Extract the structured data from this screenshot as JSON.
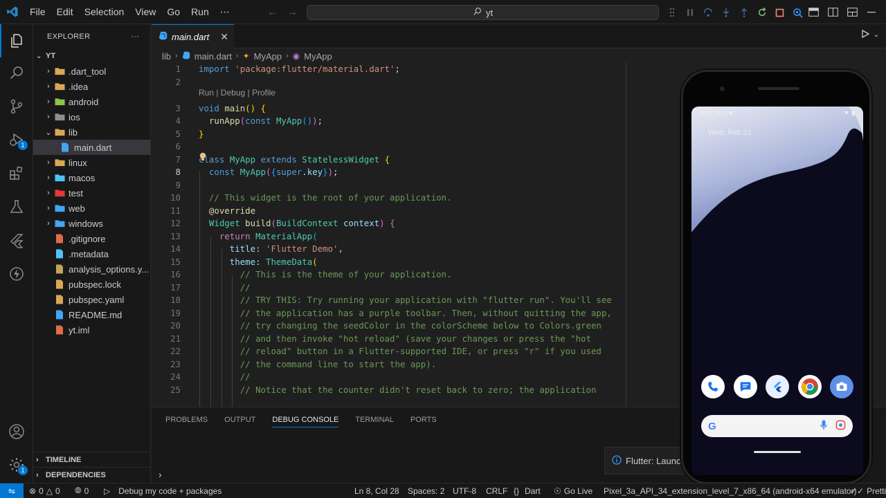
{
  "titlebar": {
    "menu": [
      "File",
      "Edit",
      "Selection",
      "View",
      "Go",
      "Run",
      "⋯"
    ],
    "search_text": "yt"
  },
  "activity": {
    "debug_badge": "1",
    "settings_badge": "1"
  },
  "sidebar": {
    "title": "EXPLORER",
    "more": "···",
    "root": "YT",
    "items": [
      {
        "label": ".dart_tool",
        "kind": "folder",
        "icon_color": "#d9a857"
      },
      {
        "label": ".idea",
        "kind": "folder",
        "icon_color": "#d9a857"
      },
      {
        "label": "android",
        "kind": "folder",
        "icon_color": "#8bc34a"
      },
      {
        "label": "ios",
        "kind": "folder",
        "icon_color": "#8e8e8e"
      },
      {
        "label": "lib",
        "kind": "folder-open",
        "icon_color": "#d9a857"
      },
      {
        "label": "main.dart",
        "kind": "file",
        "icon_color": "#42a5f5",
        "selected": true
      },
      {
        "label": "linux",
        "kind": "folder",
        "icon_color": "#d9a857"
      },
      {
        "label": "macos",
        "kind": "folder",
        "icon_color": "#4fc3f7"
      },
      {
        "label": "test",
        "kind": "folder",
        "icon_color": "#e53935"
      },
      {
        "label": "web",
        "kind": "folder",
        "icon_color": "#42a5f5"
      },
      {
        "label": "windows",
        "kind": "folder",
        "icon_color": "#42a5f5"
      },
      {
        "label": ".gitignore",
        "kind": "file",
        "icon_color": "#e06c45"
      },
      {
        "label": ".metadata",
        "kind": "file",
        "icon_color": "#4fc3f7"
      },
      {
        "label": "analysis_options.y...",
        "kind": "file",
        "icon_color": "#c2a35c"
      },
      {
        "label": "pubspec.lock",
        "kind": "file",
        "icon_color": "#d9a857"
      },
      {
        "label": "pubspec.yaml",
        "kind": "file",
        "icon_color": "#d9a857"
      },
      {
        "label": "README.md",
        "kind": "file",
        "icon_color": "#42a5f5"
      },
      {
        "label": "yt.iml",
        "kind": "file",
        "icon_color": "#e06c45"
      }
    ],
    "timeline": "TIMELINE",
    "dependencies": "DEPENDENCIES"
  },
  "editor": {
    "tab_label": "main.dart",
    "breadcrumb": [
      "lib",
      "main.dart",
      "MyApp",
      "MyApp"
    ],
    "codelens": "Run | Debug | Profile",
    "lines": [
      {
        "n": "1",
        "html": "<span class='kw'>import</span> <span class='str'>'package:flutter/material.dart'</span><span class='pl'>;</span>"
      },
      {
        "n": "2",
        "html": ""
      },
      {
        "n": "3",
        "html": "<span class='kw'>void</span> <span class='fn'>main</span><span class='br1'>()</span> <span class='br1'>{</span>"
      },
      {
        "n": "4",
        "html": "  <span class='fn'>runApp</span><span class='br2'>(</span><span class='kw'>const</span> <span class='ty'>MyApp</span><span class='br3'>()</span><span class='br2'>)</span><span class='pl'>;</span>"
      },
      {
        "n": "5",
        "html": "<span class='br1'>}</span>"
      },
      {
        "n": "6",
        "html": ""
      },
      {
        "n": "7",
        "html": "<span class='kw'>class</span> <span class='ty'>MyApp</span> <span class='kw'>extends</span> <span class='ty'>StatelessWidget</span> <span class='br1'>{</span>"
      },
      {
        "n": "8",
        "html": "  <span class='kw'>const</span> <span class='ty'>MyApp</span><span class='br2'>(</span><span class='br3'>{</span><span class='kw'>super</span><span class='pl'>.</span><span class='prop'>key</span><span class='br3'>}</span><span class='br2'>)</span><span class='pl'>;</span>"
      },
      {
        "n": "9",
        "html": ""
      },
      {
        "n": "10",
        "html": "  <span class='cm'>// This widget is the root of your application.</span>"
      },
      {
        "n": "11",
        "html": "  <span class='ann'>@override</span>"
      },
      {
        "n": "12",
        "html": "  <span class='ty'>Widget</span> <span class='fn'>build</span><span class='br2'>(</span><span class='ty'>BuildContext</span> <span class='prop'>context</span><span class='br2'>)</span> <span class='br2'>{</span>"
      },
      {
        "n": "13",
        "html": "    <span class='kw2'>return</span> <span class='ty'>MaterialApp</span><span class='br3'>(</span>"
      },
      {
        "n": "14",
        "html": "      <span class='prop'>title</span><span class='pl'>:</span> <span class='str'>'Flutter Demo'</span><span class='pl'>,</span>"
      },
      {
        "n": "15",
        "html": "      <span class='prop'>theme</span><span class='pl'>:</span> <span class='ty'>ThemeData</span><span class='br1'>(</span>"
      },
      {
        "n": "16",
        "html": "        <span class='cm'>// This is the theme of your application.</span>"
      },
      {
        "n": "17",
        "html": "        <span class='cm'>//</span>"
      },
      {
        "n": "18",
        "html": "        <span class='cm'>// TRY THIS: Try running your application with \"flutter run\". You'll see</span>"
      },
      {
        "n": "19",
        "html": "        <span class='cm'>// the application has a purple toolbar. Then, without quitting the app,</span>"
      },
      {
        "n": "20",
        "html": "        <span class='cm'>// try changing the seedColor in the colorScheme below to Colors.green</span>"
      },
      {
        "n": "21",
        "html": "        <span class='cm'>// and then invoke \"hot reload\" (save your changes or press the \"hot</span>"
      },
      {
        "n": "22",
        "html": "        <span class='cm'>// reload\" button in a Flutter-supported IDE, or press \"r\" if you used</span>"
      },
      {
        "n": "23",
        "html": "        <span class='cm'>// the command line to start the app).</span>"
      },
      {
        "n": "24",
        "html": "        <span class='cm'>//</span>"
      },
      {
        "n": "25",
        "html": "        <span class='cm'>// Notice that the counter didn't reset back to zero; the application</span>"
      }
    ]
  },
  "panel": {
    "tabs": [
      "PROBLEMS",
      "OUTPUT",
      "DEBUG CONSOLE",
      "TERMINAL",
      "PORTS"
    ],
    "active_tab": "DEBUG CONSOLE",
    "prompt": "›",
    "toast": "Flutter: Launc"
  },
  "statusbar": {
    "errors": "0",
    "warnings": "0",
    "ports": "0",
    "debug_config": "Debug my code + packages",
    "position": "Ln 8, Col 28",
    "spaces": "Spaces: 2",
    "encoding": "UTF-8",
    "eol": "CRLF",
    "language": "Dart",
    "live": "Go Live",
    "device": "Pixel_3a_API_34_extension_level_7_x86_64 (android-x64 emulator)",
    "prettier": "Prettie"
  },
  "emulator": {
    "time": "9:25",
    "date": "Wed, Feb 21",
    "dock_apps": [
      "phone-icon",
      "messages-icon",
      "flutter-icon",
      "chrome-icon",
      "camera-icon"
    ]
  },
  "colors": {
    "accent": "#0078d4",
    "editor_bg": "#1f1f1f",
    "chrome_bg": "#181818"
  }
}
